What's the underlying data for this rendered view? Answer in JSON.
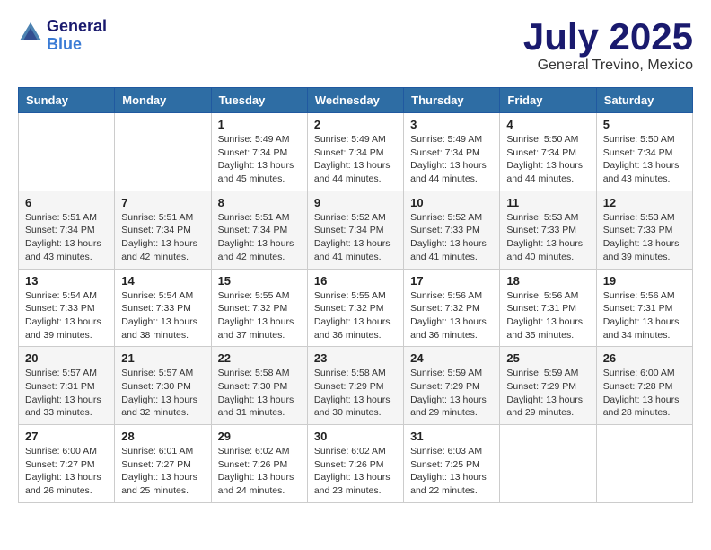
{
  "header": {
    "logo_general": "General",
    "logo_blue": "Blue",
    "month": "July 2025",
    "location": "General Trevino, Mexico"
  },
  "days_of_week": [
    "Sunday",
    "Monday",
    "Tuesday",
    "Wednesday",
    "Thursday",
    "Friday",
    "Saturday"
  ],
  "weeks": [
    [
      {
        "num": "",
        "sunrise": "",
        "sunset": "",
        "daylight": ""
      },
      {
        "num": "",
        "sunrise": "",
        "sunset": "",
        "daylight": ""
      },
      {
        "num": "1",
        "sunrise": "Sunrise: 5:49 AM",
        "sunset": "Sunset: 7:34 PM",
        "daylight": "Daylight: 13 hours and 45 minutes."
      },
      {
        "num": "2",
        "sunrise": "Sunrise: 5:49 AM",
        "sunset": "Sunset: 7:34 PM",
        "daylight": "Daylight: 13 hours and 44 minutes."
      },
      {
        "num": "3",
        "sunrise": "Sunrise: 5:49 AM",
        "sunset": "Sunset: 7:34 PM",
        "daylight": "Daylight: 13 hours and 44 minutes."
      },
      {
        "num": "4",
        "sunrise": "Sunrise: 5:50 AM",
        "sunset": "Sunset: 7:34 PM",
        "daylight": "Daylight: 13 hours and 44 minutes."
      },
      {
        "num": "5",
        "sunrise": "Sunrise: 5:50 AM",
        "sunset": "Sunset: 7:34 PM",
        "daylight": "Daylight: 13 hours and 43 minutes."
      }
    ],
    [
      {
        "num": "6",
        "sunrise": "Sunrise: 5:51 AM",
        "sunset": "Sunset: 7:34 PM",
        "daylight": "Daylight: 13 hours and 43 minutes."
      },
      {
        "num": "7",
        "sunrise": "Sunrise: 5:51 AM",
        "sunset": "Sunset: 7:34 PM",
        "daylight": "Daylight: 13 hours and 42 minutes."
      },
      {
        "num": "8",
        "sunrise": "Sunrise: 5:51 AM",
        "sunset": "Sunset: 7:34 PM",
        "daylight": "Daylight: 13 hours and 42 minutes."
      },
      {
        "num": "9",
        "sunrise": "Sunrise: 5:52 AM",
        "sunset": "Sunset: 7:34 PM",
        "daylight": "Daylight: 13 hours and 41 minutes."
      },
      {
        "num": "10",
        "sunrise": "Sunrise: 5:52 AM",
        "sunset": "Sunset: 7:33 PM",
        "daylight": "Daylight: 13 hours and 41 minutes."
      },
      {
        "num": "11",
        "sunrise": "Sunrise: 5:53 AM",
        "sunset": "Sunset: 7:33 PM",
        "daylight": "Daylight: 13 hours and 40 minutes."
      },
      {
        "num": "12",
        "sunrise": "Sunrise: 5:53 AM",
        "sunset": "Sunset: 7:33 PM",
        "daylight": "Daylight: 13 hours and 39 minutes."
      }
    ],
    [
      {
        "num": "13",
        "sunrise": "Sunrise: 5:54 AM",
        "sunset": "Sunset: 7:33 PM",
        "daylight": "Daylight: 13 hours and 39 minutes."
      },
      {
        "num": "14",
        "sunrise": "Sunrise: 5:54 AM",
        "sunset": "Sunset: 7:33 PM",
        "daylight": "Daylight: 13 hours and 38 minutes."
      },
      {
        "num": "15",
        "sunrise": "Sunrise: 5:55 AM",
        "sunset": "Sunset: 7:32 PM",
        "daylight": "Daylight: 13 hours and 37 minutes."
      },
      {
        "num": "16",
        "sunrise": "Sunrise: 5:55 AM",
        "sunset": "Sunset: 7:32 PM",
        "daylight": "Daylight: 13 hours and 36 minutes."
      },
      {
        "num": "17",
        "sunrise": "Sunrise: 5:56 AM",
        "sunset": "Sunset: 7:32 PM",
        "daylight": "Daylight: 13 hours and 36 minutes."
      },
      {
        "num": "18",
        "sunrise": "Sunrise: 5:56 AM",
        "sunset": "Sunset: 7:31 PM",
        "daylight": "Daylight: 13 hours and 35 minutes."
      },
      {
        "num": "19",
        "sunrise": "Sunrise: 5:56 AM",
        "sunset": "Sunset: 7:31 PM",
        "daylight": "Daylight: 13 hours and 34 minutes."
      }
    ],
    [
      {
        "num": "20",
        "sunrise": "Sunrise: 5:57 AM",
        "sunset": "Sunset: 7:31 PM",
        "daylight": "Daylight: 13 hours and 33 minutes."
      },
      {
        "num": "21",
        "sunrise": "Sunrise: 5:57 AM",
        "sunset": "Sunset: 7:30 PM",
        "daylight": "Daylight: 13 hours and 32 minutes."
      },
      {
        "num": "22",
        "sunrise": "Sunrise: 5:58 AM",
        "sunset": "Sunset: 7:30 PM",
        "daylight": "Daylight: 13 hours and 31 minutes."
      },
      {
        "num": "23",
        "sunrise": "Sunrise: 5:58 AM",
        "sunset": "Sunset: 7:29 PM",
        "daylight": "Daylight: 13 hours and 30 minutes."
      },
      {
        "num": "24",
        "sunrise": "Sunrise: 5:59 AM",
        "sunset": "Sunset: 7:29 PM",
        "daylight": "Daylight: 13 hours and 29 minutes."
      },
      {
        "num": "25",
        "sunrise": "Sunrise: 5:59 AM",
        "sunset": "Sunset: 7:29 PM",
        "daylight": "Daylight: 13 hours and 29 minutes."
      },
      {
        "num": "26",
        "sunrise": "Sunrise: 6:00 AM",
        "sunset": "Sunset: 7:28 PM",
        "daylight": "Daylight: 13 hours and 28 minutes."
      }
    ],
    [
      {
        "num": "27",
        "sunrise": "Sunrise: 6:00 AM",
        "sunset": "Sunset: 7:27 PM",
        "daylight": "Daylight: 13 hours and 26 minutes."
      },
      {
        "num": "28",
        "sunrise": "Sunrise: 6:01 AM",
        "sunset": "Sunset: 7:27 PM",
        "daylight": "Daylight: 13 hours and 25 minutes."
      },
      {
        "num": "29",
        "sunrise": "Sunrise: 6:02 AM",
        "sunset": "Sunset: 7:26 PM",
        "daylight": "Daylight: 13 hours and 24 minutes."
      },
      {
        "num": "30",
        "sunrise": "Sunrise: 6:02 AM",
        "sunset": "Sunset: 7:26 PM",
        "daylight": "Daylight: 13 hours and 23 minutes."
      },
      {
        "num": "31",
        "sunrise": "Sunrise: 6:03 AM",
        "sunset": "Sunset: 7:25 PM",
        "daylight": "Daylight: 13 hours and 22 minutes."
      },
      {
        "num": "",
        "sunrise": "",
        "sunset": "",
        "daylight": ""
      },
      {
        "num": "",
        "sunrise": "",
        "sunset": "",
        "daylight": ""
      }
    ]
  ]
}
